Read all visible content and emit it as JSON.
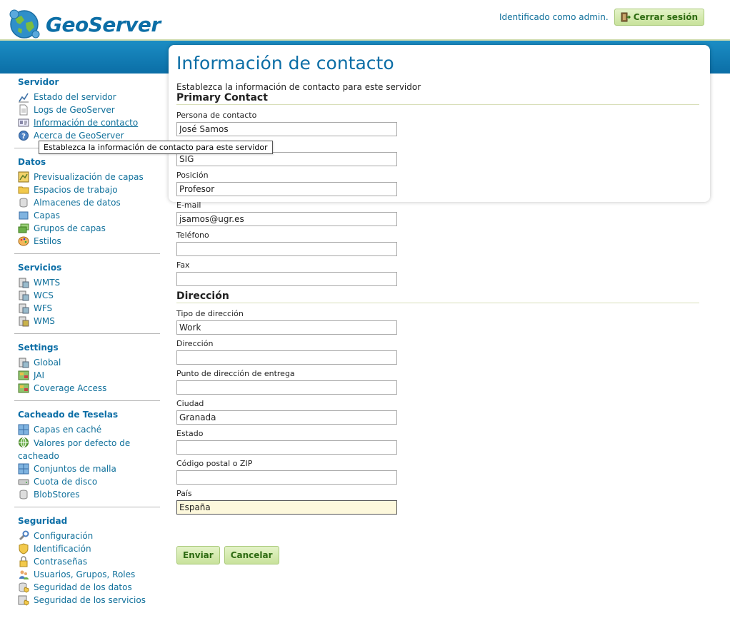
{
  "header": {
    "logo_text": "GeoServer",
    "user_text": "Identificado como admin.",
    "logout_label": "Cerrar sesión"
  },
  "tooltip": "Establezca la información de contacto para este servidor",
  "sidebar": {
    "servidor": {
      "title": "Servidor",
      "items": [
        "Estado del servidor",
        "Logs de GeoServer",
        "Información de contacto",
        "Acerca de GeoServer"
      ]
    },
    "datos": {
      "title": "Datos",
      "items": [
        "Previsualización de capas",
        "Espacios de trabajo",
        "Almacenes de datos",
        "Capas",
        "Grupos de capas",
        "Estilos"
      ]
    },
    "servicios": {
      "title": "Servicios",
      "items": [
        "WMTS",
        "WCS",
        "WFS",
        "WMS"
      ]
    },
    "settings": {
      "title": "Settings",
      "items": [
        "Global",
        "JAI",
        "Coverage Access"
      ]
    },
    "cacheado": {
      "title": "Cacheado de Teselas",
      "items": [
        "Capas en caché",
        "Valores por defecto de cacheado",
        "Conjuntos de malla",
        "Cuota de disco",
        "BlobStores"
      ]
    },
    "seguridad": {
      "title": "Seguridad",
      "items": [
        "Configuración",
        "Identificación",
        "Contraseñas",
        "Usuarios, Grupos, Roles",
        "Seguridad de los datos",
        "Seguridad de los servicios"
      ]
    }
  },
  "main": {
    "title": "Información de contacto",
    "description": "Establezca la información de contacto para este servidor",
    "primary_contact_heading": "Primary Contact",
    "address_heading": "Dirección",
    "fields": {
      "persona": {
        "label": "Persona de contacto",
        "value": "José Samos"
      },
      "organizacion": {
        "value": "SIG"
      },
      "posicion": {
        "label": "Posición",
        "value": "Profesor"
      },
      "email": {
        "label": "E-mail",
        "value": "jsamos@ugr.es"
      },
      "telefono": {
        "label": "Teléfono",
        "value": ""
      },
      "fax": {
        "label": "Fax",
        "value": ""
      },
      "tipo_direccion": {
        "label": "Tipo de dirección",
        "value": "Work"
      },
      "direccion": {
        "label": "Dirección",
        "value": ""
      },
      "punto_entrega": {
        "label": "Punto de dirección de entrega",
        "value": ""
      },
      "ciudad": {
        "label": "Ciudad",
        "value": "Granada"
      },
      "estado": {
        "label": "Estado",
        "value": ""
      },
      "codigo_postal": {
        "label": "Código postal o ZIP",
        "value": ""
      },
      "pais": {
        "label": "País",
        "value": "España"
      }
    },
    "save_label": "Enviar",
    "cancel_label": "Cancelar"
  },
  "colors": {
    "brand_blue": "#0c6ea6",
    "link_blue": "#10709b",
    "button_green": "#c8e29b",
    "focused_field": "#fdf8dc"
  }
}
